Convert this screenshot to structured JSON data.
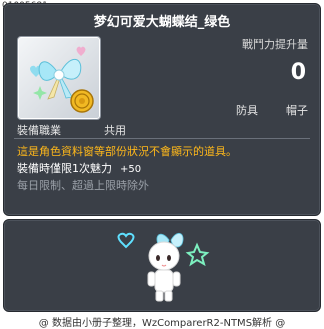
{
  "item_id": "01005681",
  "title": "梦幻可爱大蝴蝶结_绿色",
  "power": {
    "label": "戰鬥力提升量",
    "value": "0"
  },
  "slots": [
    "防具",
    "帽子"
  ],
  "job": {
    "label": "裝備職業",
    "value": "共用"
  },
  "description": "這是角色資料窗等部份狀況不會顯示的道具。",
  "effect": {
    "text": "裝備時僅限1次魅力",
    "bonus": "+50"
  },
  "limit_text": "每日限制、超過上限時除外",
  "footer": "@ 数据由小册子整理，WzComparerR2-NTMS解析 @",
  "colors": {
    "panel_bg": "#3a3f47",
    "description": "#ffb81a",
    "muted": "#9aa0a8",
    "accent_ribbon": "#9fe3f5",
    "coin": "#f1b923"
  },
  "icons": [
    "ribbon-item-icon",
    "gold-coin-badge-icon",
    "character-preview"
  ]
}
